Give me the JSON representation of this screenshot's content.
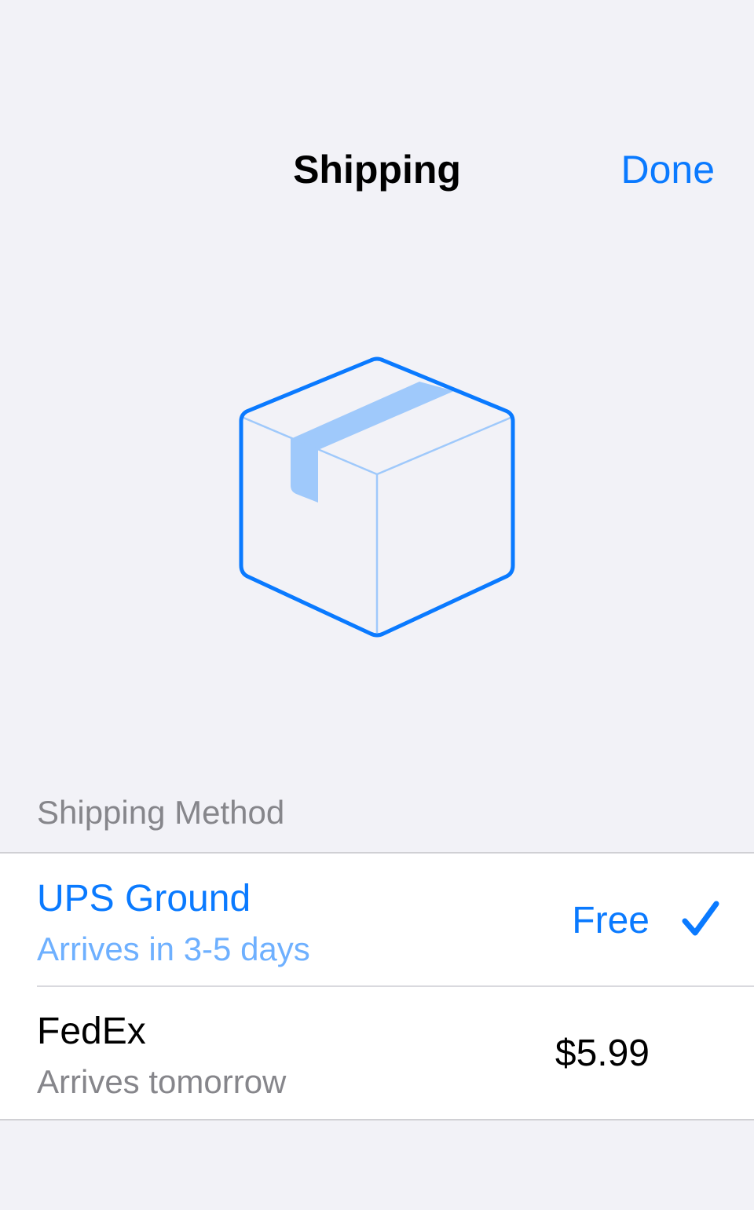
{
  "nav": {
    "title": "Shipping",
    "done_label": "Done"
  },
  "hero": {
    "icon": "shipping-box-icon"
  },
  "section": {
    "header": "Shipping Method"
  },
  "methods": [
    {
      "name": "UPS Ground",
      "detail": "Arrives in 3-5 days",
      "price": "Free",
      "selected": true
    },
    {
      "name": "FedEx",
      "detail": "Arrives tomorrow",
      "price": "$5.99",
      "selected": false
    }
  ],
  "colors": {
    "accent": "#0a7aff",
    "background": "#f2f2f7",
    "secondary_text": "#86868b"
  }
}
